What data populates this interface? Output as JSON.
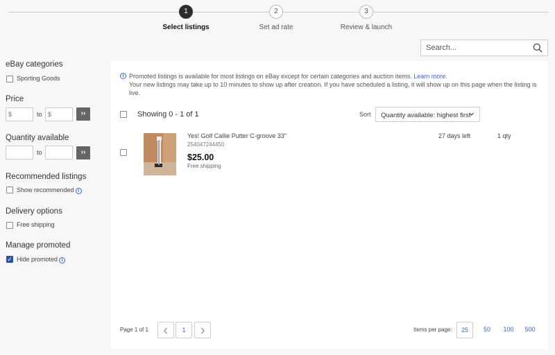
{
  "stepper": {
    "steps": [
      {
        "number": "1",
        "label": "Select listings",
        "active": true
      },
      {
        "number": "2",
        "label": "Set ad rate",
        "active": false
      },
      {
        "number": "3",
        "label": "Review & launch",
        "active": false
      }
    ]
  },
  "search": {
    "placeholder": "Search...",
    "icon": "search-icon"
  },
  "sidebar": {
    "categories": {
      "title": "eBay categories",
      "option": "Sporting Goods",
      "checked": false
    },
    "price": {
      "title": "Price",
      "min_placeholder": "$",
      "to": "to",
      "max_placeholder": "$",
      "go": "››"
    },
    "quantity": {
      "title": "Quantity available",
      "min_value": "",
      "to": "to",
      "max_value": "",
      "go": "››"
    },
    "recommended": {
      "title": "Recommended listings",
      "option": "Show recommended",
      "checked": false
    },
    "delivery": {
      "title": "Delivery options",
      "option": "Free shipping",
      "checked": false
    },
    "promoted": {
      "title": "Manage promoted",
      "option": "Hide promoted",
      "checked": true
    }
  },
  "notice": {
    "line1": "Promoted listings is available for most listings on eBay except for certain categories and auction items.",
    "link": "Learn more.",
    "line2": "Your new listings may take up to 10 minutes to show up after creation. If you have scheduled a listing, it will show up on this page when the listing is live."
  },
  "results": {
    "showing": "Showing 0 - 1 of 1",
    "sort_label": "Sort",
    "sort_value": "Quantity available: highest first"
  },
  "listing": {
    "title": "Yes! Golf Callie Putter C-groove 33\"",
    "item_id": "254047244450",
    "price": "$25.00",
    "shipping": "Free shipping",
    "days_left": "27 days left",
    "quantity": "1 qty"
  },
  "pagination": {
    "page_label": "Page 1 of 1",
    "prev": "‹",
    "current": "1",
    "next": "›",
    "items_per_page_label": "Items per page:",
    "items_per_page": [
      "25",
      "50",
      "100",
      "500"
    ],
    "selected_items_per_page": "25"
  },
  "colors": {
    "accent": "#3665c9",
    "checkbox_checked": "#2d4fa5",
    "active_step": "#2d2d2d"
  }
}
